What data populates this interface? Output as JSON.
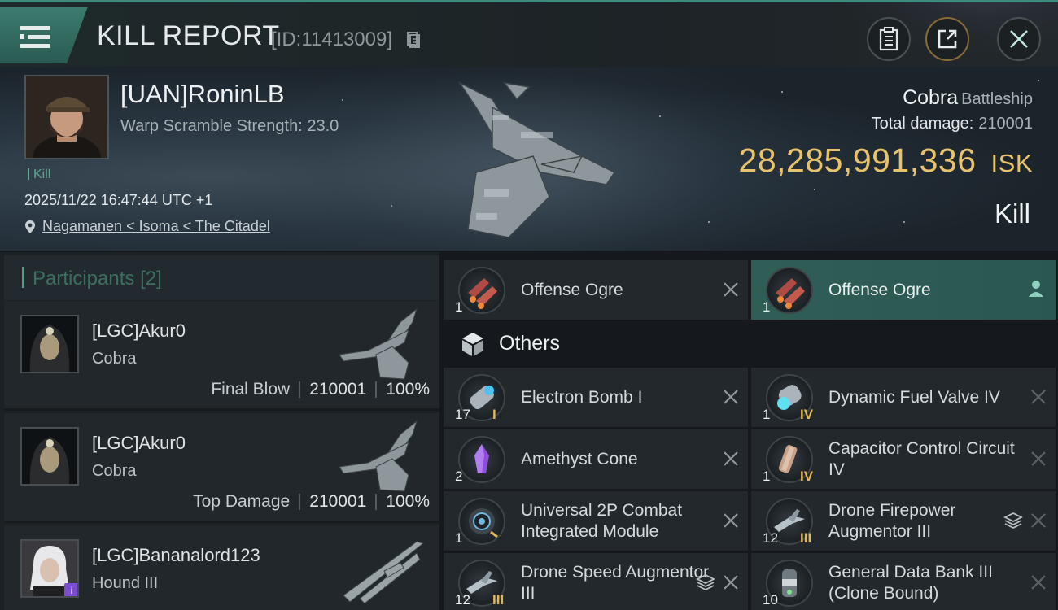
{
  "header": {
    "title": "KILL REPORT",
    "report_id": "[ID:11413009]"
  },
  "victim": {
    "name": "[UAN]RoninLB",
    "warp_scramble": "Warp Scramble Strength: 23.0",
    "kill_tag": "Kill",
    "datetime": "2025/11/22 16:47:44 UTC +1",
    "location": "Nagamanen < Isoma < The Citadel",
    "ship": "Cobra",
    "ship_class": "Battleship",
    "total_damage_label": "Total damage:",
    "total_damage": "210001",
    "isk_value": "28,285,991,336",
    "isk_unit": "ISK",
    "result": "Kill"
  },
  "participants": {
    "title": "Participants",
    "count": "[2]",
    "list": [
      {
        "name": "[LGC]Akur0",
        "ship": "Cobra",
        "label": "Final Blow",
        "damage": "210001",
        "percent": "100%"
      },
      {
        "name": "[LGC]Akur0",
        "ship": "Cobra",
        "label": "Top Damage",
        "damage": "210001",
        "percent": "100%"
      },
      {
        "name": "[LGC]Bananalord123",
        "ship": "Hound III"
      }
    ]
  },
  "items": {
    "offense_left": {
      "name": "Offense  Ogre",
      "qty": "1"
    },
    "offense_right": {
      "name": "Offense  Ogre",
      "qty": "1"
    },
    "others_label": "Others",
    "others": [
      {
        "name": "Electron Bomb I",
        "qty": "17",
        "tier": "I"
      },
      {
        "name": "Dynamic Fuel Valve IV",
        "qty": "1",
        "tier": "IV"
      },
      {
        "name": "Amethyst Cone",
        "qty": "2",
        "tier": ""
      },
      {
        "name": "Capacitor Control Circuit IV",
        "qty": "1",
        "tier": "IV"
      },
      {
        "name": "Universal 2P Combat Integrated Module",
        "qty": "1",
        "tier": ""
      },
      {
        "name": "Drone Firepower Augmentor III",
        "qty": "12",
        "tier": "III"
      },
      {
        "name": "Drone Speed Augmentor III",
        "qty": "12",
        "tier": "III"
      },
      {
        "name": "General Data Bank III (Clone Bound)",
        "qty": "10",
        "tier": ""
      }
    ]
  },
  "colors": {
    "accent": "#3e8a7c",
    "isk": "#e9c36b",
    "highlight": "#2f5e57"
  }
}
